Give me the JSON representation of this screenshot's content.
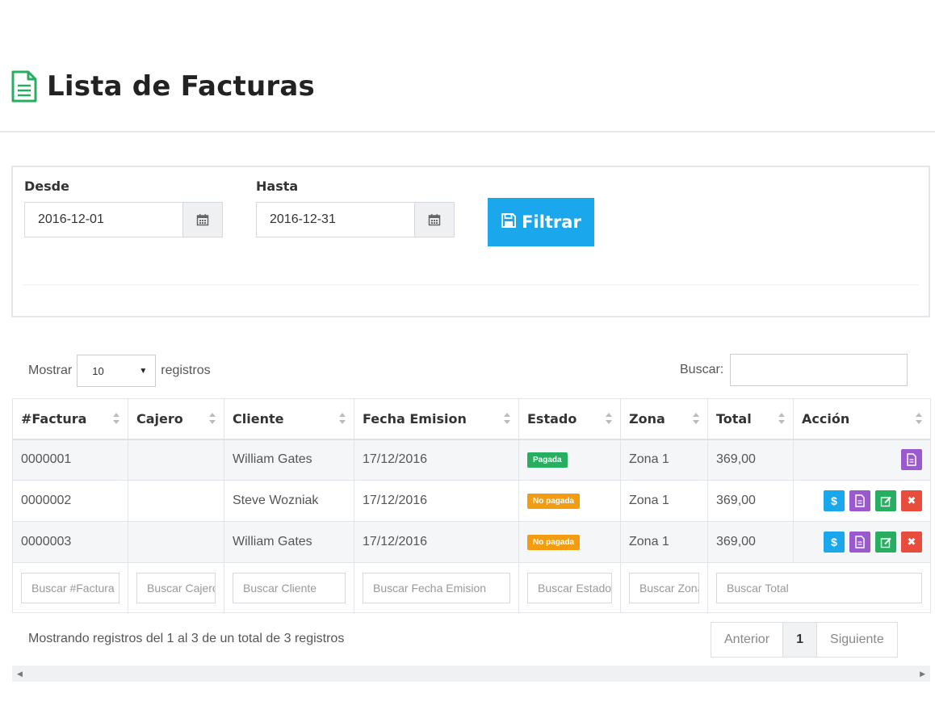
{
  "header": {
    "title": "Lista de Facturas",
    "icon": "file-text-icon",
    "icon_color": "#27ae60"
  },
  "filter": {
    "from_label": "Desde",
    "from_value": "2016-12-01",
    "to_label": "Hasta",
    "to_value": "2016-12-31",
    "button_label": "Filtrar",
    "button_color": "#1aa7ec"
  },
  "table_controls": {
    "show_label": "Mostrar",
    "page_size": "10",
    "records_label": "registros",
    "search_label": "Buscar:",
    "search_value": ""
  },
  "table": {
    "columns": [
      "#Factura",
      "Cajero",
      "Cliente",
      "Fecha Emision",
      "Estado",
      "Zona",
      "Total",
      "Acción"
    ],
    "rows": [
      {
        "invoice": "0000001",
        "cashier": "",
        "client": "William Gates",
        "date": "17/12/2016",
        "status": "Pagada",
        "zone": "Zona 1",
        "total": "369,00"
      },
      {
        "invoice": "0000002",
        "cashier": "",
        "client": "Steve Wozniak",
        "date": "17/12/2016",
        "status": "No pagada",
        "zone": "Zona 1",
        "total": "369,00"
      },
      {
        "invoice": "0000003",
        "cashier": "",
        "client": "William Gates",
        "date": "17/12/2016",
        "status": "No pagada",
        "zone": "Zona 1",
        "total": "369,00"
      }
    ],
    "column_filters": [
      "Buscar #Factura",
      "Buscar Cajero",
      "Buscar Cliente",
      "Buscar Fecha Emision",
      "Buscar Estado",
      "Buscar Zona",
      "Buscar Total"
    ],
    "status_colors": {
      "paid": "#27ae60",
      "unpaid": "#f39c12"
    }
  },
  "footer": {
    "info": "Mostrando registros del 1 al 3 de un total de 3 registros",
    "prev_label": "Anterior",
    "current_page": "1",
    "next_label": "Siguiente"
  }
}
